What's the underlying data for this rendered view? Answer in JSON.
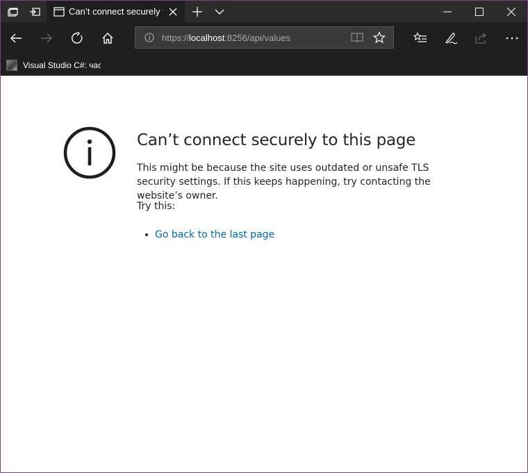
{
  "tabstrip": {
    "tab_title": "Can’t connect securely t",
    "icons": [
      "tab-preview-icon",
      "set-aside-tabs-icon",
      "new-tab-icon",
      "tab-list-icon"
    ],
    "window_controls": [
      "minimize-icon",
      "maximize-icon",
      "close-icon"
    ]
  },
  "navbar": {
    "url_scheme": "https://",
    "url_host": "localhost",
    "url_rest": ":8256/api/values",
    "icons": [
      "back-icon",
      "forward-icon",
      "refresh-icon",
      "home-icon",
      "info-icon",
      "reading-view-icon",
      "favorite-star-icon",
      "favorites-list-icon",
      "pen-icon",
      "share-icon",
      "more-icon"
    ]
  },
  "favorites": {
    "item_label": "Visual Studio C#: час"
  },
  "error": {
    "title": "Can’t connect securely to this page",
    "description": "This might be because the site uses outdated or unsafe TLS security settings. If this keeps happening, try contacting the website’s owner.",
    "try_this": "Try this:",
    "suggestions": [
      "Go back to the last page"
    ]
  },
  "colors": {
    "chrome_dark": "#1e1e1e",
    "tabstrip": "#2b2b2b",
    "link": "#0067b8",
    "text": "#262626",
    "window_border": "#7a3f8f"
  }
}
